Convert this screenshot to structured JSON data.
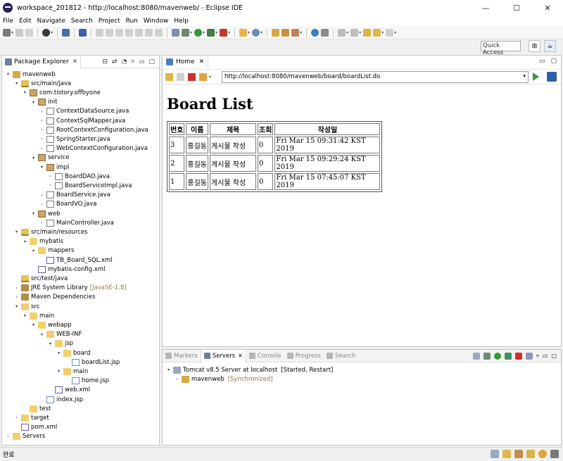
{
  "window": {
    "title": "workspace_201812 - http://localhost:8080/mavenweb/ - Eclipse IDE",
    "minimize": "—",
    "maximize": "☐",
    "close": "✕"
  },
  "menu": [
    "File",
    "Edit",
    "Navigate",
    "Search",
    "Project",
    "Run",
    "Window",
    "Help"
  ],
  "quick_access": "Quick Access",
  "package_explorer": {
    "tab_label": "Package Explorer",
    "tree": [
      {
        "label": "mavenweb",
        "icon": "project",
        "arrow": "▾"
      },
      {
        "label": "src/main/java",
        "icon": "srcfolder",
        "arrow": "▾"
      },
      {
        "label": "com.tistory.offbyone",
        "icon": "package",
        "arrow": "▾"
      },
      {
        "label": "init",
        "icon": "package",
        "arrow": "▾"
      },
      {
        "label": "ContextDataSource.java",
        "icon": "java",
        "arrow": "›"
      },
      {
        "label": "ContextSqlMapper.java",
        "icon": "java",
        "arrow": "›"
      },
      {
        "label": "RootContextConfiguration.java",
        "icon": "java",
        "arrow": "›"
      },
      {
        "label": "SpringStarter.java",
        "icon": "java",
        "arrow": "›"
      },
      {
        "label": "WebContextConfiguration.java",
        "icon": "java",
        "arrow": "›"
      },
      {
        "label": "service",
        "icon": "package",
        "arrow": "▾"
      },
      {
        "label": "impl",
        "icon": "package",
        "arrow": "▾"
      },
      {
        "label": "BoardDAO.java",
        "icon": "java",
        "arrow": "›"
      },
      {
        "label": "BoardServiceImpl.java",
        "icon": "java",
        "arrow": "›"
      },
      {
        "label": "BoardService.java",
        "icon": "java",
        "arrow": "›"
      },
      {
        "label": "BoardVO.java",
        "icon": "java",
        "arrow": "›"
      },
      {
        "label": "web",
        "icon": "package",
        "arrow": "▾"
      },
      {
        "label": "MainController.java",
        "icon": "java",
        "arrow": "›"
      },
      {
        "label": "src/main/resources",
        "icon": "srcfolder",
        "arrow": "▾"
      },
      {
        "label": "mybatis",
        "icon": "folder",
        "arrow": "▾"
      },
      {
        "label": "mappers",
        "icon": "folder",
        "arrow": "▾"
      },
      {
        "label": "TB_Board_SQL.xml",
        "icon": "xml",
        "arrow": ""
      },
      {
        "label": "mybatis-config.xml",
        "icon": "xml",
        "arrow": ""
      },
      {
        "label": "src/test/java",
        "icon": "srcfolder",
        "arrow": ""
      },
      {
        "label": "JRE System Library",
        "extra": "[JavaSE-1.8]",
        "icon": "lib",
        "arrow": "›"
      },
      {
        "label": "Maven Dependencies",
        "icon": "lib",
        "arrow": "›"
      },
      {
        "label": "src",
        "icon": "folder",
        "arrow": "▾"
      },
      {
        "label": "main",
        "icon": "folder",
        "arrow": "▾"
      },
      {
        "label": "webapp",
        "icon": "folder",
        "arrow": "▾"
      },
      {
        "label": "WEB-INF",
        "icon": "folder",
        "arrow": "▾"
      },
      {
        "label": "jsp",
        "icon": "folder",
        "arrow": "▾"
      },
      {
        "label": "board",
        "icon": "folder",
        "arrow": "▾"
      },
      {
        "label": "boardList.jsp",
        "icon": "jsp",
        "arrow": ""
      },
      {
        "label": "main",
        "icon": "folder",
        "arrow": "▾"
      },
      {
        "label": "home.jsp",
        "icon": "jsp",
        "arrow": ""
      },
      {
        "label": "web.xml",
        "icon": "xml",
        "arrow": ""
      },
      {
        "label": "index.jsp",
        "icon": "jsp",
        "arrow": ""
      },
      {
        "label": "test",
        "icon": "folder",
        "arrow": ""
      },
      {
        "label": "target",
        "icon": "folder",
        "arrow": "›"
      },
      {
        "label": "pom.xml",
        "icon": "xml",
        "arrow": ""
      },
      {
        "label": "Servers",
        "icon": "folder",
        "arrow": "›"
      }
    ]
  },
  "editor": {
    "tab_label": "Home",
    "url": "http://localhost:8080/mavenweb/board/boardList.do",
    "page_title": "Board List",
    "table": {
      "headers": [
        "번호",
        "이름",
        "제목",
        "조회",
        "작성일"
      ],
      "rows": [
        [
          "3",
          "홍길동",
          "게시물 작성",
          "0",
          "Fri Mar 15 09:31:42 KST 2019"
        ],
        [
          "2",
          "홍길동",
          "게시물 작성",
          "0",
          "Fri Mar 15 09:29:24 KST 2019"
        ],
        [
          "1",
          "홍길동",
          "게시물 작성",
          "0",
          "Fri Mar 15 07:45:07 KST 2019"
        ]
      ]
    }
  },
  "servers_view": {
    "tabs": [
      "Markers",
      "Servers",
      "Console",
      "Progress",
      "Search"
    ],
    "active_tab": "Servers",
    "server": {
      "name": "Tomcat v8.5 Server at localhost",
      "state": "[Started, Restart]"
    },
    "module": {
      "name": "mavenweb",
      "state": "[Synchronized]"
    }
  },
  "status": {
    "text": "완료"
  }
}
